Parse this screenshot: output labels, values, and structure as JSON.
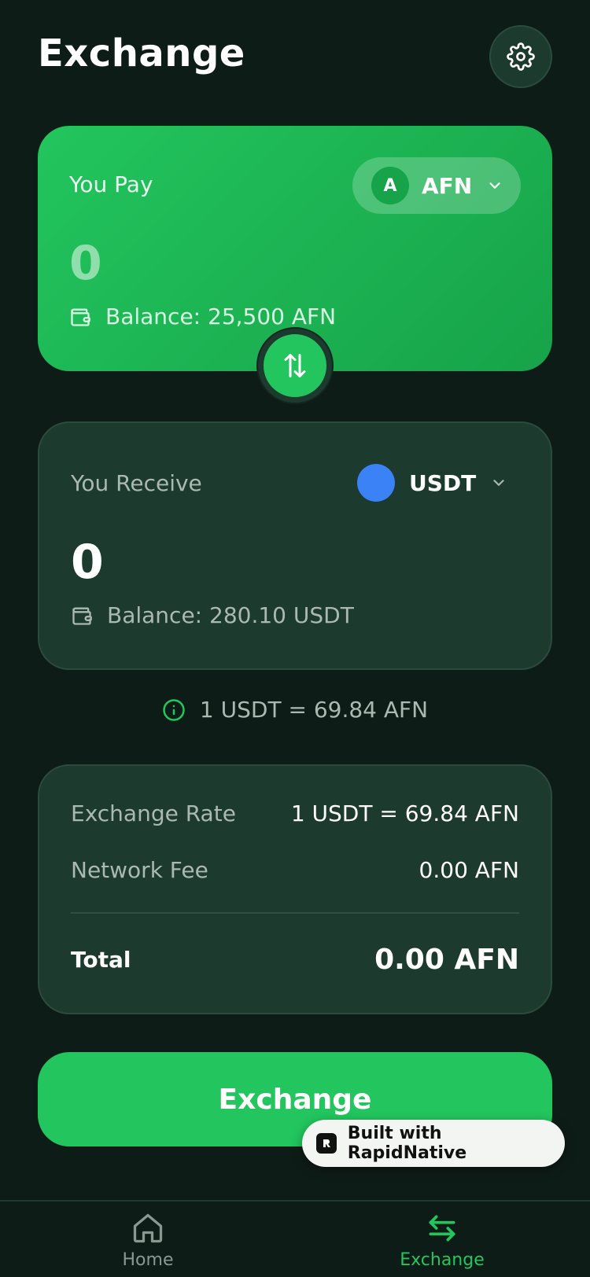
{
  "header": {
    "title": "Exchange",
    "settings_icon": "gear-icon"
  },
  "pay_card": {
    "label": "You Pay",
    "currency_badge": "A",
    "currency_code": "AFN",
    "amount": "0",
    "balance": "Balance: 25,500 AFN"
  },
  "swap": {
    "icon": "swap-arrows-icon"
  },
  "receive_card": {
    "label": "You Receive",
    "currency_code": "USDT",
    "amount": "0",
    "balance": "Balance: 280.10 USDT"
  },
  "rate_hint": "1 USDT = 69.84 AFN",
  "summary": {
    "rate_label": "Exchange Rate",
    "rate_value": "1 USDT = 69.84 AFN",
    "fee_label": "Network Fee",
    "fee_value": "0.00 AFN",
    "total_label": "Total",
    "total_value": "0.00 AFN"
  },
  "exchange_button": "Exchange",
  "badge": "Built with RapidNative",
  "nav": [
    {
      "label": "Home",
      "icon": "home-icon",
      "active": false
    },
    {
      "label": "Exchange",
      "icon": "exchange-arrows-icon",
      "active": true
    }
  ],
  "colors": {
    "background": "#0e1c17",
    "card": "#1d3a2f",
    "accent": "#22c55e",
    "usdt": "#3b82f6"
  }
}
